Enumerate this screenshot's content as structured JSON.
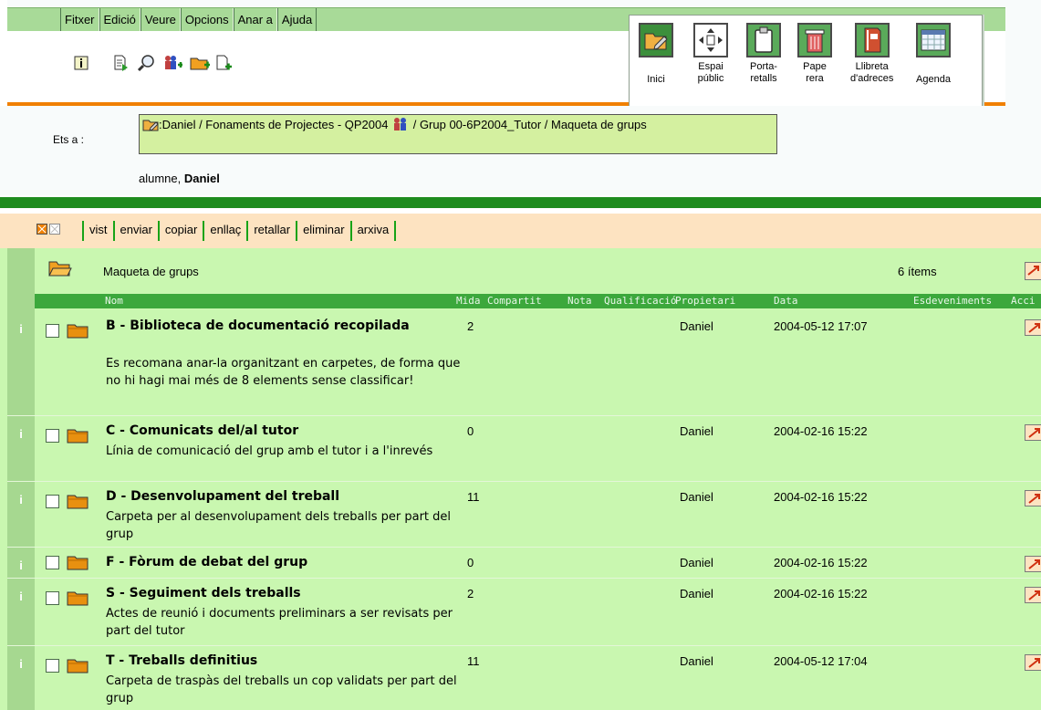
{
  "menu": [
    "Fitxer",
    "Edició",
    "Veure",
    "Opcions",
    "Anar a",
    "Ajuda"
  ],
  "nav": [
    {
      "label": "Inici",
      "icon": "folder-pencil-icon"
    },
    {
      "label": "Espai\npúblic",
      "icon": "move-arrows-icon"
    },
    {
      "label": "Porta-\nretalls",
      "icon": "clipboard-icon"
    },
    {
      "label": "Pape\nrera",
      "icon": "trash-icon"
    },
    {
      "label": "Llibreta\nd'adreces",
      "icon": "address-book-icon"
    },
    {
      "label": "Agenda",
      "icon": "calendar-icon"
    }
  ],
  "location": {
    "label": "Ets a :",
    "part1": ":Daniel / Fonaments de Projectes - QP2004",
    "part2": "/ Grup 00-6P2004_Tutor / Maqueta de grups",
    "user_prefix": "alumne, ",
    "user_name": "Daniel"
  },
  "actions": [
    "vist",
    "enviar",
    "copiar",
    "enllaç",
    "retallar",
    "eliminar",
    "arxiva"
  ],
  "folder": {
    "name": "Maqueta de grups",
    "count": "6 ítems"
  },
  "columns": [
    "Nom",
    "Mida",
    "Compartit",
    "Nota",
    "Qualificació",
    "Propietari",
    "Data",
    "Esdeveniments",
    "Acci"
  ],
  "rows": [
    {
      "title": "B - Biblioteca de documentació recopilada",
      "desc": "Es recomana anar-la organitzant en carpetes, de forma que no hi hagi mai més de 8 elements sense classificar!",
      "size": "2",
      "owner": "Daniel",
      "date": "2004-05-12 17:07"
    },
    {
      "title": "C - Comunicats del/al tutor",
      "desc": "Línia de comunicació del grup amb el tutor i a l'inrevés",
      "size": "0",
      "owner": "Daniel",
      "date": "2004-02-16 15:22"
    },
    {
      "title": "D - Desenvolupament del treball",
      "desc": "Carpeta per al desenvolupament dels treballs per part del grup",
      "size": "11",
      "owner": "Daniel",
      "date": "2004-02-16 15:22"
    },
    {
      "title": "F - Fòrum de debat del grup",
      "desc": "",
      "size": "0",
      "owner": "Daniel",
      "date": "2004-02-16 15:22"
    },
    {
      "title": "S - Seguiment dels treballs",
      "desc": "Actes de reunió i documents preliminars a ser revisats per part del tutor",
      "size": "2",
      "owner": "Daniel",
      "date": "2004-02-16 15:22"
    },
    {
      "title": "T - Treballs definitius",
      "desc": "Carpeta de traspàs del treballs un cop validats per part del grup",
      "size": "11",
      "owner": "Daniel",
      "date": "2004-05-12 17:04"
    }
  ],
  "info_glyph": "i",
  "colors": {
    "menu_bg": "#a8da98",
    "list_bg": "#c9f7b0",
    "header_green": "#3ca83c",
    "action_bg": "#fde3c1",
    "accent_orange": "#f08000"
  }
}
